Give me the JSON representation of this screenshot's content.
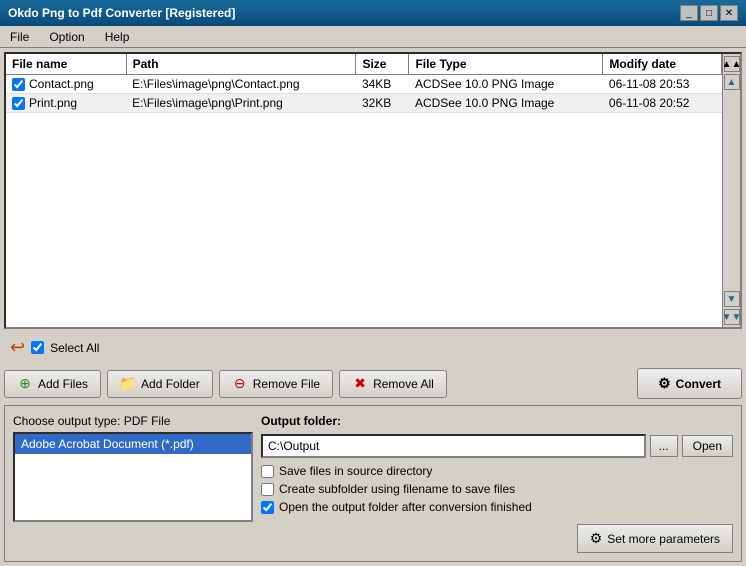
{
  "titleBar": {
    "title": "Okdo Png to Pdf Converter [Registered]",
    "controls": [
      "minimize",
      "maximize",
      "close"
    ]
  },
  "menuBar": {
    "items": [
      "File",
      "Option",
      "Help"
    ]
  },
  "fileTable": {
    "columns": [
      "File name",
      "Path",
      "Size",
      "File Type",
      "Modify date"
    ],
    "rows": [
      {
        "checked": true,
        "name": "Contact.png",
        "path": "E:\\Files\\image\\png\\Contact.png",
        "size": "34KB",
        "fileType": "ACDSee 10.0 PNG Image",
        "modifyDate": "06-11-08 20:53"
      },
      {
        "checked": true,
        "name": "Print.png",
        "path": "E:\\Files\\image\\png\\Print.png",
        "size": "32KB",
        "fileType": "ACDSee 10.0 PNG Image",
        "modifyDate": "06-11-08 20:52"
      }
    ]
  },
  "selectAll": {
    "label": "Select All",
    "checked": true
  },
  "buttons": {
    "addFiles": "Add Files",
    "addFolder": "Add Folder",
    "removeFile": "Remove File",
    "removeAll": "Remove All",
    "convert": "Convert"
  },
  "bottomPanel": {
    "outputTypeLabel": "Choose output type:",
    "outputTypeValue": "PDF File",
    "outputTypeList": [
      "Adobe Acrobat Document (*.pdf)"
    ],
    "outputFolderLabel": "Output folder:",
    "outputFolderValue": "C:\\Output",
    "browseBtnLabel": "...",
    "openBtnLabel": "Open",
    "checkboxes": [
      {
        "label": "Save files in source directory",
        "checked": false
      },
      {
        "label": "Create subfolder using filename to save files",
        "checked": false
      },
      {
        "label": "Open the output folder after conversion finished",
        "checked": true
      }
    ],
    "setMoreParams": "Set more parameters"
  }
}
